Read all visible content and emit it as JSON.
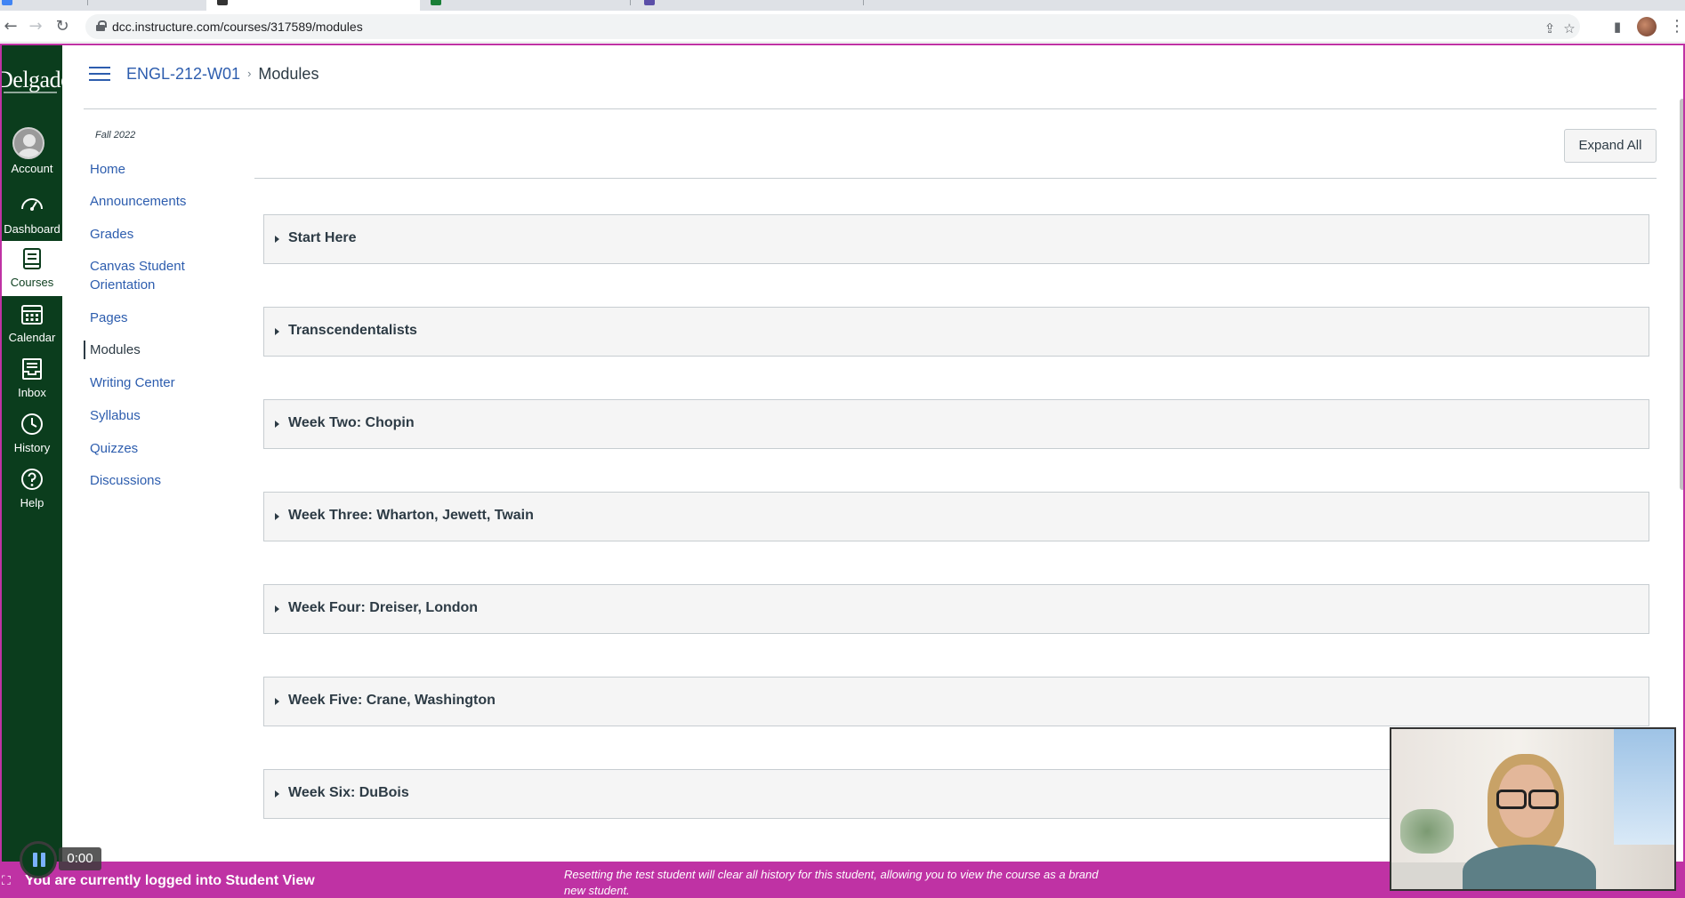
{
  "browser": {
    "url": "dcc.instructure.com/courses/317589/modules"
  },
  "global_nav": {
    "logo_text": "Delgado",
    "items": [
      {
        "label": "Account",
        "icon": "account-avatar"
      },
      {
        "label": "Dashboard",
        "icon": "speedometer-icon"
      },
      {
        "label": "Courses",
        "icon": "book-icon",
        "active": true
      },
      {
        "label": "Calendar",
        "icon": "calendar-icon"
      },
      {
        "label": "Inbox",
        "icon": "inbox-icon"
      },
      {
        "label": "History",
        "icon": "clock-icon"
      },
      {
        "label": "Help",
        "icon": "help-icon"
      }
    ],
    "bg_color": "#0b3d1d"
  },
  "header": {
    "course": "ENGL-212-W01",
    "separator": "›",
    "page": "Modules"
  },
  "course_nav": {
    "term": "Fall 2022",
    "items": [
      {
        "label": "Home"
      },
      {
        "label": "Announcements"
      },
      {
        "label": "Grades"
      },
      {
        "label": "Canvas Student Orientation"
      },
      {
        "label": "Pages"
      },
      {
        "label": "Modules",
        "active": true
      },
      {
        "label": "Writing Center"
      },
      {
        "label": "Syllabus"
      },
      {
        "label": "Quizzes"
      },
      {
        "label": "Discussions"
      }
    ]
  },
  "main": {
    "expand_all_label": "Expand All",
    "modules": [
      {
        "title": "Start Here"
      },
      {
        "title": "Transcendentalists"
      },
      {
        "title": "Week Two: Chopin"
      },
      {
        "title": "Week Three: Wharton, Jewett, Twain"
      },
      {
        "title": "Week Four: Dreiser, London"
      },
      {
        "title": "Week Five: Crane, Washington"
      },
      {
        "title": "Week Six: DuBois"
      }
    ]
  },
  "student_view_banner": {
    "message": "You are currently logged into Student View",
    "reset_note": "Resetting the test student will clear all history for this student, allowing you to view the course as a brand new student.",
    "color": "#bf32a4"
  },
  "recorder": {
    "time": "0:00"
  },
  "colors": {
    "link": "#2d5dae",
    "text": "#2d3b45"
  }
}
